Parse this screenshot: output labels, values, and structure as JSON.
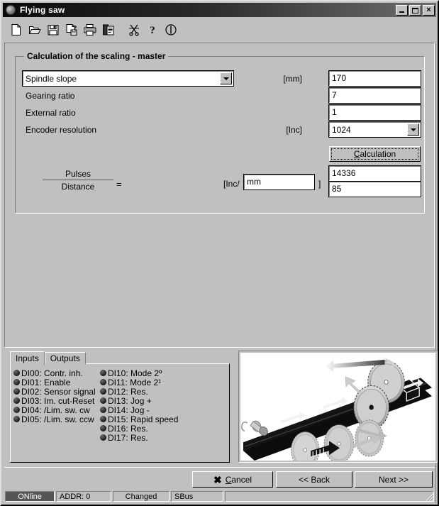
{
  "window": {
    "title": "Flying saw",
    "icon": "app-circle-icon",
    "buttons": {
      "minimize": "minimize",
      "maximize": "maximize",
      "close": "×"
    }
  },
  "toolbar": {
    "items": [
      {
        "name": "new-file-icon",
        "tip": "New"
      },
      {
        "name": "open-folder-icon",
        "tip": "Open"
      },
      {
        "name": "save-disk-icon",
        "tip": "Save"
      },
      {
        "name": "save-as-icon",
        "tip": "Save as"
      },
      {
        "name": "print-icon",
        "tip": "Print"
      },
      {
        "name": "copy-paste-icon",
        "tip": "Copy"
      }
    ],
    "items2": [
      {
        "name": "scissors-icon",
        "tip": "Cut"
      },
      {
        "name": "help-question-icon",
        "tip": "Help"
      },
      {
        "name": "info-power-icon",
        "tip": "Info"
      }
    ]
  },
  "groupbox": {
    "title": "Calculation of the scaling - master"
  },
  "form": {
    "spindle_slope": {
      "label": "Spindle slope",
      "unit": "[mm]",
      "value": "170"
    },
    "gearing_ratio": {
      "label": "Gearing ratio",
      "unit": "",
      "value": "7"
    },
    "external_ratio": {
      "label": "External ratio",
      "unit": "",
      "value": "1"
    },
    "encoder_resolution": {
      "label": "Encoder resolution",
      "unit": "[Inc]",
      "value": "1024"
    }
  },
  "calculation": {
    "button_label_pre": "C",
    "button_label_post": "alculation",
    "button_label": "Calculation",
    "fraction_numerator": "Pulses",
    "fraction_denominator": "Distance",
    "equals": "=",
    "unit_prefix": "[Inc/",
    "unit_value": "mm",
    "unit_suffix": "]",
    "result_numerator": "14336",
    "result_denominator": "85"
  },
  "tabs": {
    "items": [
      {
        "label": "Inputs",
        "active": true
      },
      {
        "label": "Outputs",
        "active": false
      }
    ]
  },
  "inputs": {
    "column_left": [
      "DI00: Contr. inh.",
      "DI01: Enable",
      "DI02: Sensor signal",
      "DI03: Im. cut-Reset",
      "DI04: /Lim. sw. cw",
      "DI05: /Lim. sw. ccw"
    ],
    "column_right": [
      "DI10: Mode 2º",
      "DI11: Mode 2¹",
      "DI12: Res.",
      "DI13: Jog +",
      "DI14: Jog -",
      "DI15: Rapid speed",
      "DI16: Res.",
      "DI17: Res."
    ]
  },
  "illustration": {
    "name": "flying-saw-conveyor-diagram"
  },
  "footer": {
    "cancel_icon": "✖",
    "cancel_pre": "C",
    "cancel_post": "ancel",
    "cancel_label": "Cancel",
    "back_label": "<< Back",
    "next_label": "Next >>"
  },
  "statusbar": {
    "connection": "ONline",
    "address": "ADDR: 0",
    "state": "Changed",
    "bus": "SBus",
    "extra": ""
  },
  "colors": {
    "face": "#c0c0c0",
    "title_dark": "#0a0a0a",
    "title_light": "#6e6e6e",
    "field_bg": "#ffffff",
    "status_online_bg": "#555555"
  }
}
